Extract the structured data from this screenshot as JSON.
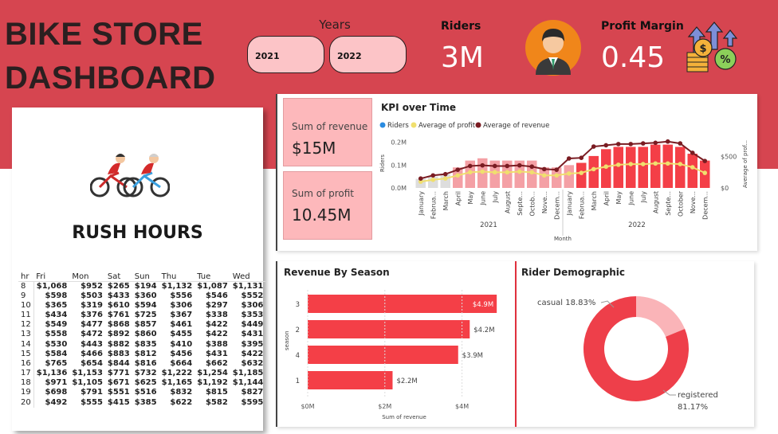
{
  "header": {
    "title_line1": "BIKE STORE",
    "title_line2": "DASHBOARD",
    "years_label": "Years",
    "years": [
      "2021",
      "2022"
    ],
    "riders_label": "Riders",
    "riders_value": "3M",
    "profit_margin_label": "Profit Margin",
    "profit_margin_value": "0.45"
  },
  "rush_hours": {
    "title": "RUSH HOURS",
    "columns": [
      "hr",
      "Fri",
      "Mon",
      "Sat",
      "Sun",
      "Thu",
      "Tue",
      "Wed"
    ],
    "rows": [
      [
        "8",
        "$1,068",
        "$952",
        "$265",
        "$194",
        "$1,132",
        "$1,087",
        "$1,131"
      ],
      [
        "9",
        "$598",
        "$503",
        "$433",
        "$360",
        "$556",
        "$546",
        "$552"
      ],
      [
        "10",
        "$365",
        "$319",
        "$610",
        "$594",
        "$306",
        "$297",
        "$306"
      ],
      [
        "11",
        "$434",
        "$376",
        "$761",
        "$725",
        "$367",
        "$338",
        "$353"
      ],
      [
        "12",
        "$549",
        "$477",
        "$868",
        "$857",
        "$461",
        "$422",
        "$449"
      ],
      [
        "13",
        "$558",
        "$472",
        "$892",
        "$860",
        "$455",
        "$422",
        "$431"
      ],
      [
        "14",
        "$530",
        "$443",
        "$882",
        "$835",
        "$410",
        "$388",
        "$395"
      ],
      [
        "15",
        "$584",
        "$466",
        "$883",
        "$812",
        "$456",
        "$431",
        "$422"
      ],
      [
        "16",
        "$765",
        "$654",
        "$844",
        "$816",
        "$664",
        "$662",
        "$632"
      ],
      [
        "17",
        "$1,136",
        "$1,153",
        "$771",
        "$732",
        "$1,222",
        "$1,254",
        "$1,185"
      ],
      [
        "18",
        "$971",
        "$1,105",
        "$671",
        "$625",
        "$1,165",
        "$1,192",
        "$1,144"
      ],
      [
        "19",
        "$698",
        "$791",
        "$551",
        "$516",
        "$832",
        "$815",
        "$827"
      ],
      [
        "20",
        "$492",
        "$555",
        "$415",
        "$385",
        "$622",
        "$582",
        "$595"
      ]
    ]
  },
  "cards": {
    "revenue_label": "Sum of revenue",
    "revenue_value": "$15M",
    "profit_label": "Sum of profit",
    "profit_value": "10.45M"
  },
  "colors": {
    "header_bg": "#d64550",
    "card_pink": "#fdb8bb",
    "bar_red": "#f43f47",
    "bar_light": "#f4a0a5",
    "bar_grey": "#dddddd",
    "riders_blue": "#2a8be0",
    "profit_yellow": "#f0df6e",
    "revenue_dark": "#7a1c22",
    "registered": "#ee3f4a",
    "casual": "#fab4b8"
  },
  "icons": {
    "bikers": "bikers-illustration",
    "rider_avatar": "businessman-avatar-icon",
    "profit_icon": "money-growth-icon"
  },
  "chart_data": [
    {
      "type": "bar",
      "title": "KPI over Time",
      "legend": [
        "Riders",
        "Average of profit",
        "Average of revenue"
      ],
      "legend_position": "top-left",
      "xlabel": "Month",
      "ylabel": "Riders",
      "y2label": "Average of prof...",
      "y_ticks": [
        "0.0M",
        "0.1M",
        "0.2M"
      ],
      "y2_ticks": [
        "$0",
        "$500"
      ],
      "year_groups": [
        "2021",
        "2022"
      ],
      "categories": [
        "January",
        "Februa...",
        "March",
        "April",
        "May",
        "June",
        "July",
        "August",
        "Septe...",
        "Octob...",
        "Nove...",
        "Decem...",
        "January",
        "Februa...",
        "March",
        "April",
        "May",
        "June",
        "July",
        "August",
        "Septe...",
        "October",
        "Nove...",
        "Decem..."
      ],
      "ylim": [
        0,
        0.22
      ],
      "y2lim": [
        0,
        800
      ],
      "series": [
        {
          "name": "Riders",
          "values": [
            0.04,
            0.05,
            0.06,
            0.09,
            0.12,
            0.13,
            0.12,
            0.12,
            0.12,
            0.12,
            0.09,
            0.09,
            0.1,
            0.11,
            0.14,
            0.17,
            0.18,
            0.18,
            0.18,
            0.19,
            0.19,
            0.18,
            0.15,
            0.12
          ]
        },
        {
          "name": "Average of profit",
          "values": [
            100,
            130,
            150,
            200,
            250,
            260,
            250,
            250,
            260,
            250,
            200,
            200,
            230,
            240,
            300,
            340,
            370,
            380,
            380,
            390,
            390,
            380,
            330,
            240
          ]
        },
        {
          "name": "Average of revenue",
          "values": [
            150,
            200,
            220,
            290,
            350,
            360,
            350,
            350,
            360,
            340,
            300,
            290,
            470,
            480,
            660,
            680,
            700,
            700,
            710,
            720,
            740,
            710,
            560,
            430
          ]
        }
      ]
    },
    {
      "type": "bar",
      "title": "Revenue By Season",
      "orientation": "horizontal",
      "categories": [
        "3",
        "2",
        "4",
        "1"
      ],
      "values": [
        4.9,
        4.2,
        3.9,
        2.2
      ],
      "data_labels": [
        "$4.9M",
        "$4.2M",
        "$3.9M",
        "$2.2M"
      ],
      "xlabel": "Sum of revenue",
      "ylabel": "season",
      "x_ticks": [
        "$0M",
        "$2M",
        "$4M"
      ],
      "xlim": [
        0,
        5
      ]
    },
    {
      "type": "pie",
      "title": "Rider Demographic",
      "categories": [
        "casual",
        "registered"
      ],
      "values": [
        18.83,
        81.17
      ],
      "labels": [
        "casual 18.83%",
        "registered",
        "81.17%"
      ]
    }
  ]
}
